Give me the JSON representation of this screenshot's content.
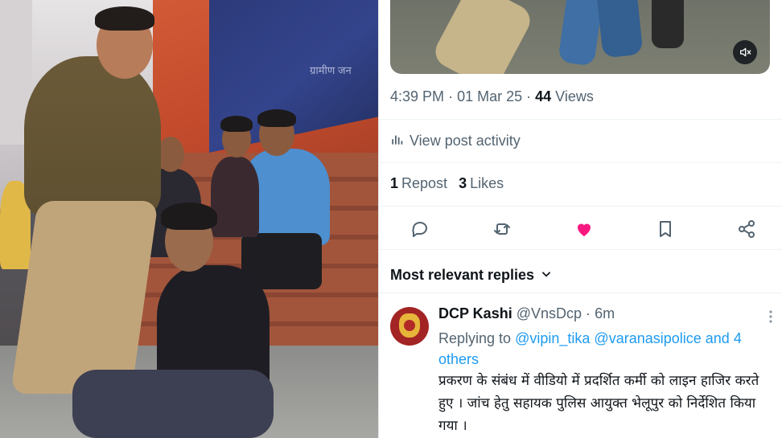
{
  "photo": {
    "banner_text": "ग्रामीण जन"
  },
  "tweet": {
    "time": "4:39 PM",
    "date": "01 Mar 25",
    "views_count": "44",
    "views_label": "Views",
    "activity_label": "View post activity",
    "reposts_count": "1",
    "reposts_label": "Repost",
    "likes_count": "3",
    "likes_label": "Likes",
    "liked": true,
    "like_color": "#f91880"
  },
  "icons": {
    "mute": "volume-mute-icon",
    "activity": "bar-chart-icon",
    "reply": "speech-bubble-icon",
    "repost": "repost-arrows-icon",
    "like": "heart-icon",
    "bookmark": "bookmark-icon",
    "share": "share-icon",
    "sort": "chevron-down-icon",
    "more": "more-dots-icon"
  },
  "replies": {
    "section_title": "Most relevant replies",
    "items": [
      {
        "name": "DCP Kashi",
        "handle": "@VnsDcp",
        "separator": "·",
        "age": "6m",
        "replying_prefix": "Replying to",
        "mention_1": "@vipin_tika",
        "mention_2": "@varanasipolice",
        "mention_rest": "and 4 others",
        "text": "प्रकरण के संबंध में वीडियो में प्रदर्शित कर्मी को लाइन हाजिर करते हुए । जांच हेतु सहायक पुलिस आयुक्त भेलूपुर को निर्देशित किया गया ।"
      }
    ]
  },
  "colors": {
    "accent": "#1d9bf0",
    "secondary_text": "#536471",
    "primary_text": "#0f1419"
  }
}
